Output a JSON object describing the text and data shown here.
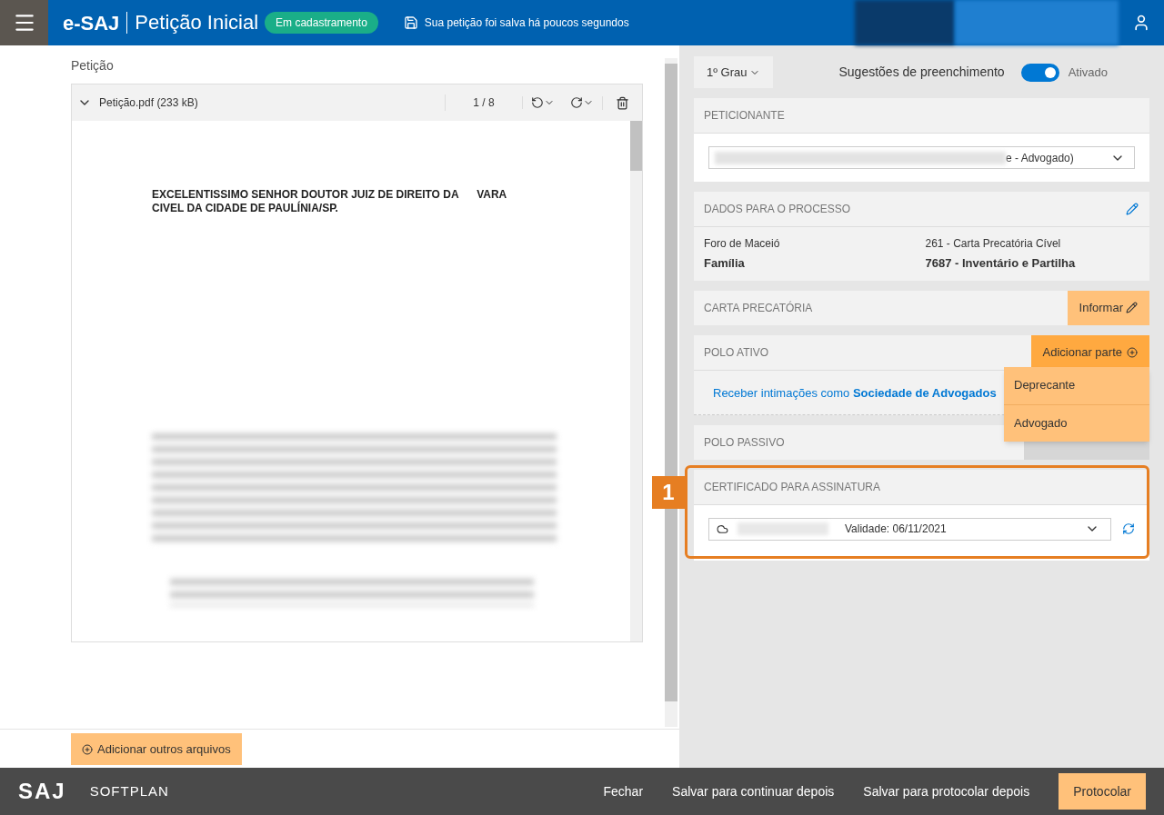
{
  "header": {
    "brand": "e-SAJ",
    "title": "Petição Inicial",
    "status_badge": "Em cadastramento",
    "save_status": "Sua petição foi salva há poucos segundos"
  },
  "left": {
    "label": "Petição",
    "viewer": {
      "file_name": "Petição.pdf (233 kB)",
      "page": "1 / 8",
      "document_heading": [
        "EXCELENTISSIMO SENHOR DOUTOR JUIZ DE DIREITO DA      VARA",
        "CIVEL DA CIDADE DE PAULÍNIA/SP."
      ]
    },
    "add_files_button": "Adicionar outros arquivos"
  },
  "right": {
    "grade": "1º Grau",
    "suggestions": {
      "label": "Sugestões de preenchimento",
      "on": true,
      "state_label": "Ativado"
    },
    "peticionante": {
      "title": "PETICIONANTE",
      "value_tail": "e - Advogado)"
    },
    "dados": {
      "title": "DADOS PARA O PROCESSO",
      "foro": "Foro de Maceió",
      "foro_value": "Família",
      "classe": "261 - Carta Precatória Cível",
      "classe_value": "7687 - Inventário e Partilha"
    },
    "carta": {
      "title": "CARTA PRECATÓRIA",
      "button": "Informar"
    },
    "polo_ativo": {
      "title": "POLO ATIVO",
      "button": "Adicionar parte",
      "link_prefix": "Receber intimações como ",
      "link_bold": "Sociedade de Advogados",
      "menu": [
        "Deprecante",
        "Advogado"
      ]
    },
    "polo_passivo": {
      "title": "POLO PASSIVO"
    },
    "certificado": {
      "title": "CERTIFICADO PARA ASSINATURA",
      "validity": "Validade: 06/11/2021",
      "callout": "1"
    }
  },
  "footer": {
    "logo": "SAJ",
    "brand": "SOFTPLAN",
    "buttons": [
      {
        "label": "Fechar",
        "kind": "plain"
      },
      {
        "label": "Salvar para continuar depois",
        "kind": "plain"
      },
      {
        "label": "Salvar para protocolar depois",
        "kind": "plain"
      },
      {
        "label": "Protocolar",
        "kind": "primary"
      }
    ]
  }
}
